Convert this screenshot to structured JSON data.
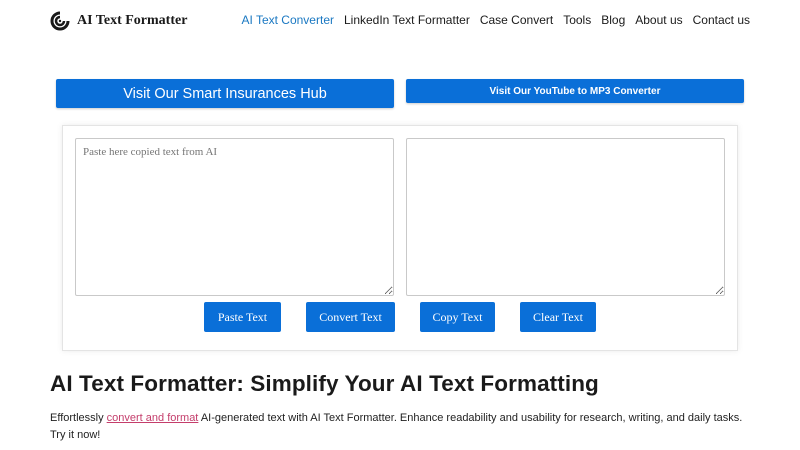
{
  "header": {
    "brand": "AI Text Formatter",
    "logo_icon": "swirl-logo-icon",
    "nav": [
      {
        "label": "AI Text Converter",
        "active": true
      },
      {
        "label": "LinkedIn Text Formatter",
        "active": false
      },
      {
        "label": "Case Convert",
        "active": false
      },
      {
        "label": "Tools",
        "active": false
      },
      {
        "label": "Blog",
        "active": false
      },
      {
        "label": "About us",
        "active": false
      },
      {
        "label": "Contact us",
        "active": false
      }
    ]
  },
  "cta": {
    "left": "Visit Our Smart Insurances Hub",
    "right": "Visit Our YouTube to MP3 Converter"
  },
  "editor": {
    "input_placeholder": "Paste here copied text from AI",
    "input_value": "",
    "output_value": "",
    "buttons": {
      "paste": "Paste Text",
      "convert": "Convert Text",
      "copy": "Copy Text",
      "clear": "Clear Text"
    }
  },
  "content": {
    "heading": "AI Text Formatter: Simplify Your AI Text Formatting",
    "intro_before": "Effortlessly ",
    "intro_link": "convert and format",
    "intro_after": " AI-generated text with AI Text Formatter. Enhance readability and usability for research, writing, and daily tasks. Try it now!"
  },
  "colors": {
    "accent": "#0a6fd8",
    "active_nav": "#1a78c2",
    "link": "#c43d6b"
  }
}
